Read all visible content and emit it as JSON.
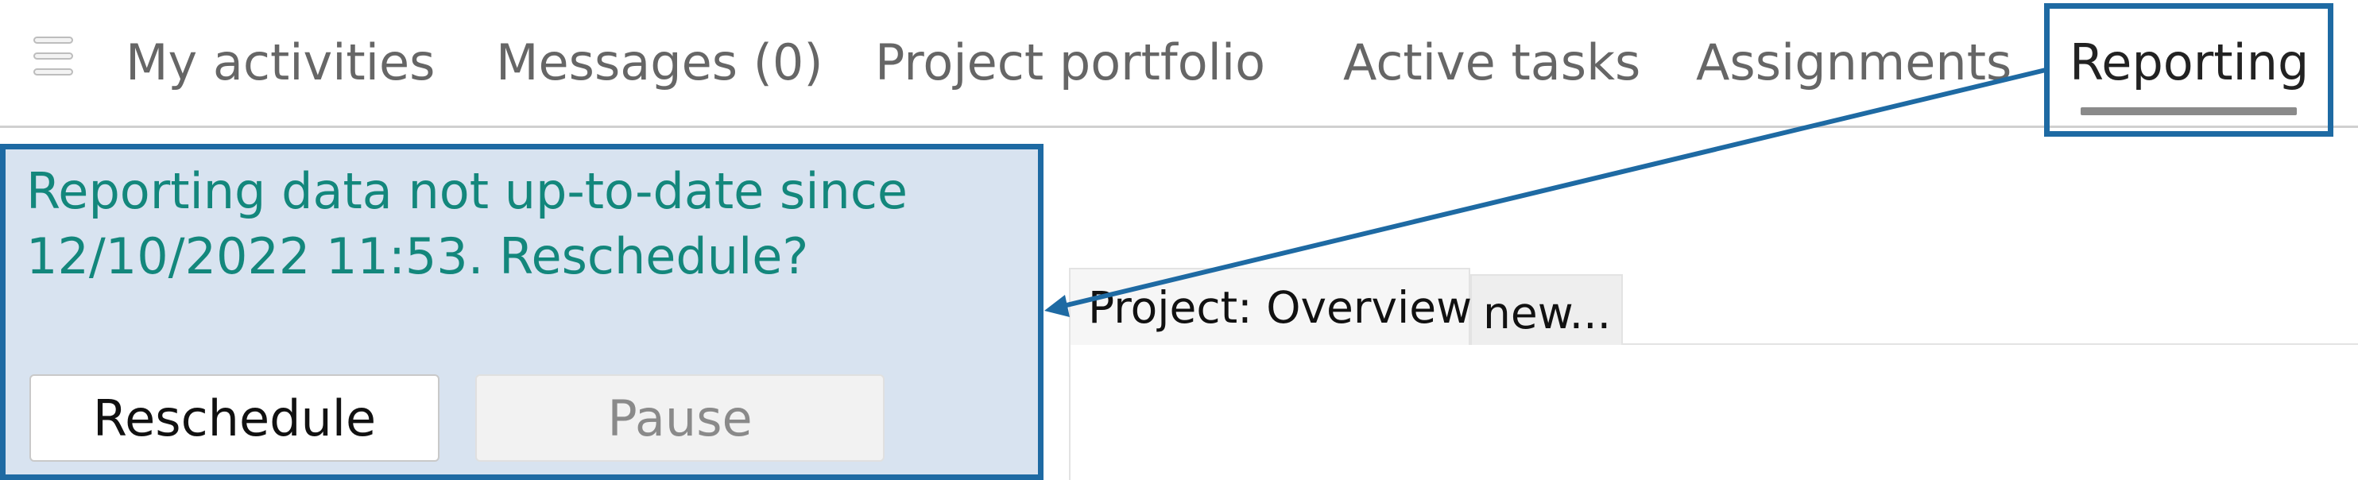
{
  "nav": {
    "menu_icon": "hamburger-menu-icon",
    "tabs": [
      {
        "label": "My activities"
      },
      {
        "label": "Messages (0)"
      },
      {
        "label": "Project portfolio"
      },
      {
        "label": "Active tasks"
      },
      {
        "label": "Assignments"
      },
      {
        "label": "Reporting",
        "active": true
      }
    ]
  },
  "callout": {
    "message_line1": "Reporting data not up-to-date since",
    "message_line2": "12/10/2022 11:53. Reschedule?",
    "reschedule_label": "Reschedule",
    "pause_label": "Pause"
  },
  "report": {
    "tabs": [
      {
        "label": "Project: Overview"
      },
      {
        "label": "new..."
      }
    ]
  },
  "colors": {
    "annotation_blue": "#1e6aa3",
    "callout_bg": "#d8e3f0",
    "message_text": "#13877c",
    "tab_text": "#666666",
    "active_tab_text": "#222222"
  }
}
